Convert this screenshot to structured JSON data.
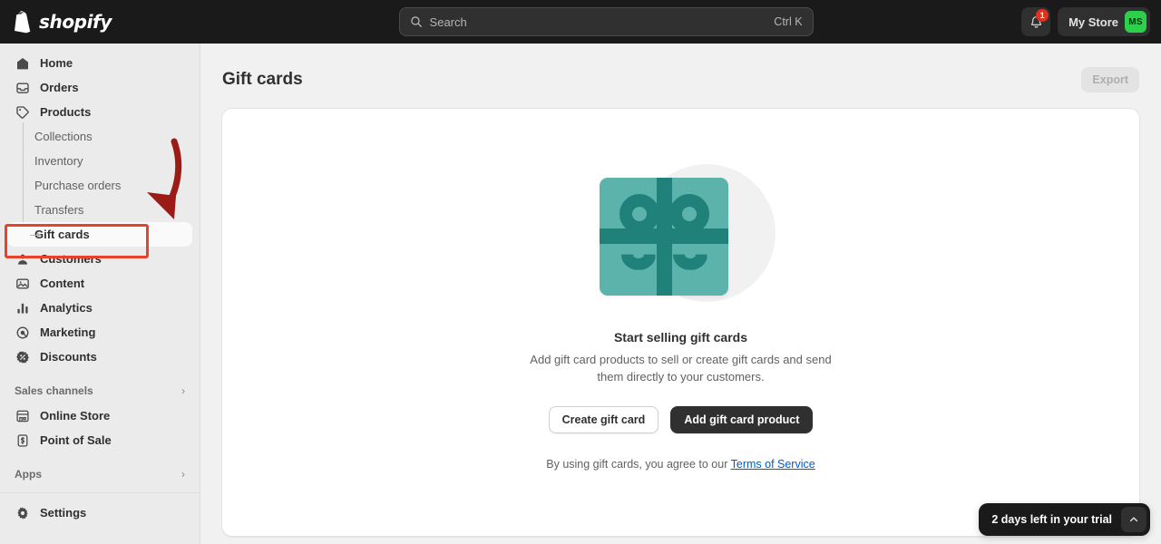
{
  "topbar": {
    "brand_name": "shopify",
    "brand_icon": "shopify-bag-icon",
    "search": {
      "icon": "search-icon",
      "placeholder": "Search",
      "shortcut": "Ctrl K",
      "value": ""
    },
    "notifications": {
      "icon": "bell-icon",
      "badge_count": "1"
    },
    "store": {
      "name": "My Store",
      "initials": "MS",
      "avatar_color": "#2bd14b"
    }
  },
  "sidebar": {
    "items": [
      {
        "label": "Home",
        "icon": "home-icon"
      },
      {
        "label": "Orders",
        "icon": "orders-inbox-icon"
      },
      {
        "label": "Products",
        "icon": "product-tag-icon"
      }
    ],
    "product_subitems": [
      {
        "label": "Collections"
      },
      {
        "label": "Inventory"
      },
      {
        "label": "Purchase orders"
      },
      {
        "label": "Transfers"
      },
      {
        "label": "Gift cards"
      }
    ],
    "items_after": [
      {
        "label": "Customers",
        "icon": "customer-person-icon"
      },
      {
        "label": "Content",
        "icon": "content-image-icon"
      },
      {
        "label": "Analytics",
        "icon": "analytics-bars-icon"
      },
      {
        "label": "Marketing",
        "icon": "marketing-target-icon"
      },
      {
        "label": "Discounts",
        "icon": "discount-burst-icon"
      }
    ],
    "sales_channels": {
      "title": "Sales channels",
      "chevron": "chevron-right-icon",
      "items": [
        {
          "label": "Online Store",
          "icon": "storefront-icon"
        },
        {
          "label": "Point of Sale",
          "icon": "pos-icon"
        }
      ]
    },
    "apps": {
      "title": "Apps",
      "chevron": "chevron-right-icon"
    },
    "settings": {
      "label": "Settings",
      "icon": "gear-icon"
    }
  },
  "main": {
    "page_title": "Gift cards",
    "export_label": "Export",
    "empty_state": {
      "illustration": "gift-card-illustration",
      "title": "Start selling gift cards",
      "description": "Add gift card products to sell or create gift cards and send them directly to your customers.",
      "secondary_button": "Create gift card",
      "primary_button": "Add gift card product",
      "tos_prefix": "By using gift cards, you agree to our ",
      "tos_link": "Terms of Service"
    }
  },
  "trial_banner": {
    "text": "2 days left in your trial",
    "toggle_icon": "chevron-up-icon"
  },
  "annotations": {
    "highlight_box_target": "Gift cards",
    "highlight_color": "#e8412c",
    "arrow_color": "#9b1b16"
  }
}
